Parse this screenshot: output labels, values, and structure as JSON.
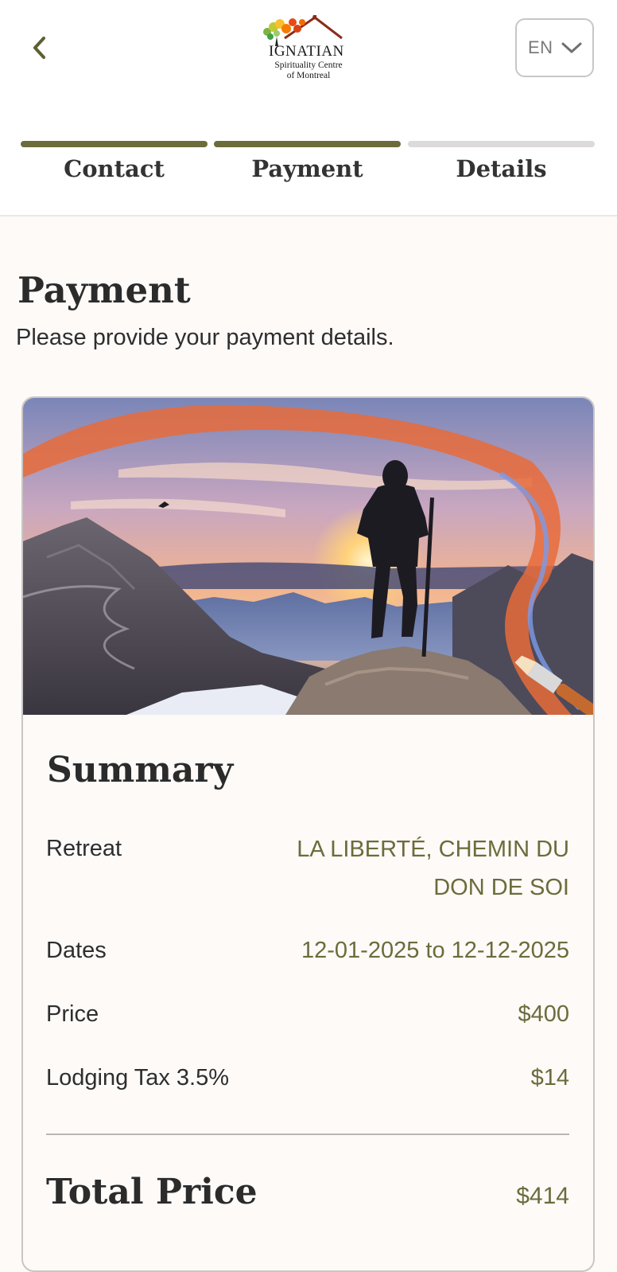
{
  "header": {
    "back_icon": "chevron-left-icon",
    "logo": {
      "name": "IGNATIAN",
      "subtitle_line1": "Spirituality Centre",
      "subtitle_line2": "of Montreal"
    },
    "language": {
      "selected": "EN",
      "icon": "chevron-down-icon"
    }
  },
  "steps": [
    {
      "label": "Contact",
      "state": "complete"
    },
    {
      "label": "Payment",
      "state": "current"
    },
    {
      "label": "Details",
      "state": "upcoming"
    }
  ],
  "page": {
    "title": "Payment",
    "subtitle": "Please provide your payment details."
  },
  "summary": {
    "title": "Summary",
    "rows": [
      {
        "label": "Retreat",
        "value_line1": "LA LIBERTÉ, CHEMIN DU",
        "value_line2": "DON DE SOI"
      },
      {
        "label": "Dates",
        "value": "12-01-2025 to 12-12-2025"
      },
      {
        "label": "Price",
        "value": "$400"
      },
      {
        "label": "Lodging Tax 3.5%",
        "value": "$14"
      }
    ],
    "total_label": "Total Price",
    "total_value": "$414"
  },
  "colors": {
    "accent": "#6b6c3b",
    "step_inactive": "#dcdadb",
    "background": "#fdfaf8"
  }
}
